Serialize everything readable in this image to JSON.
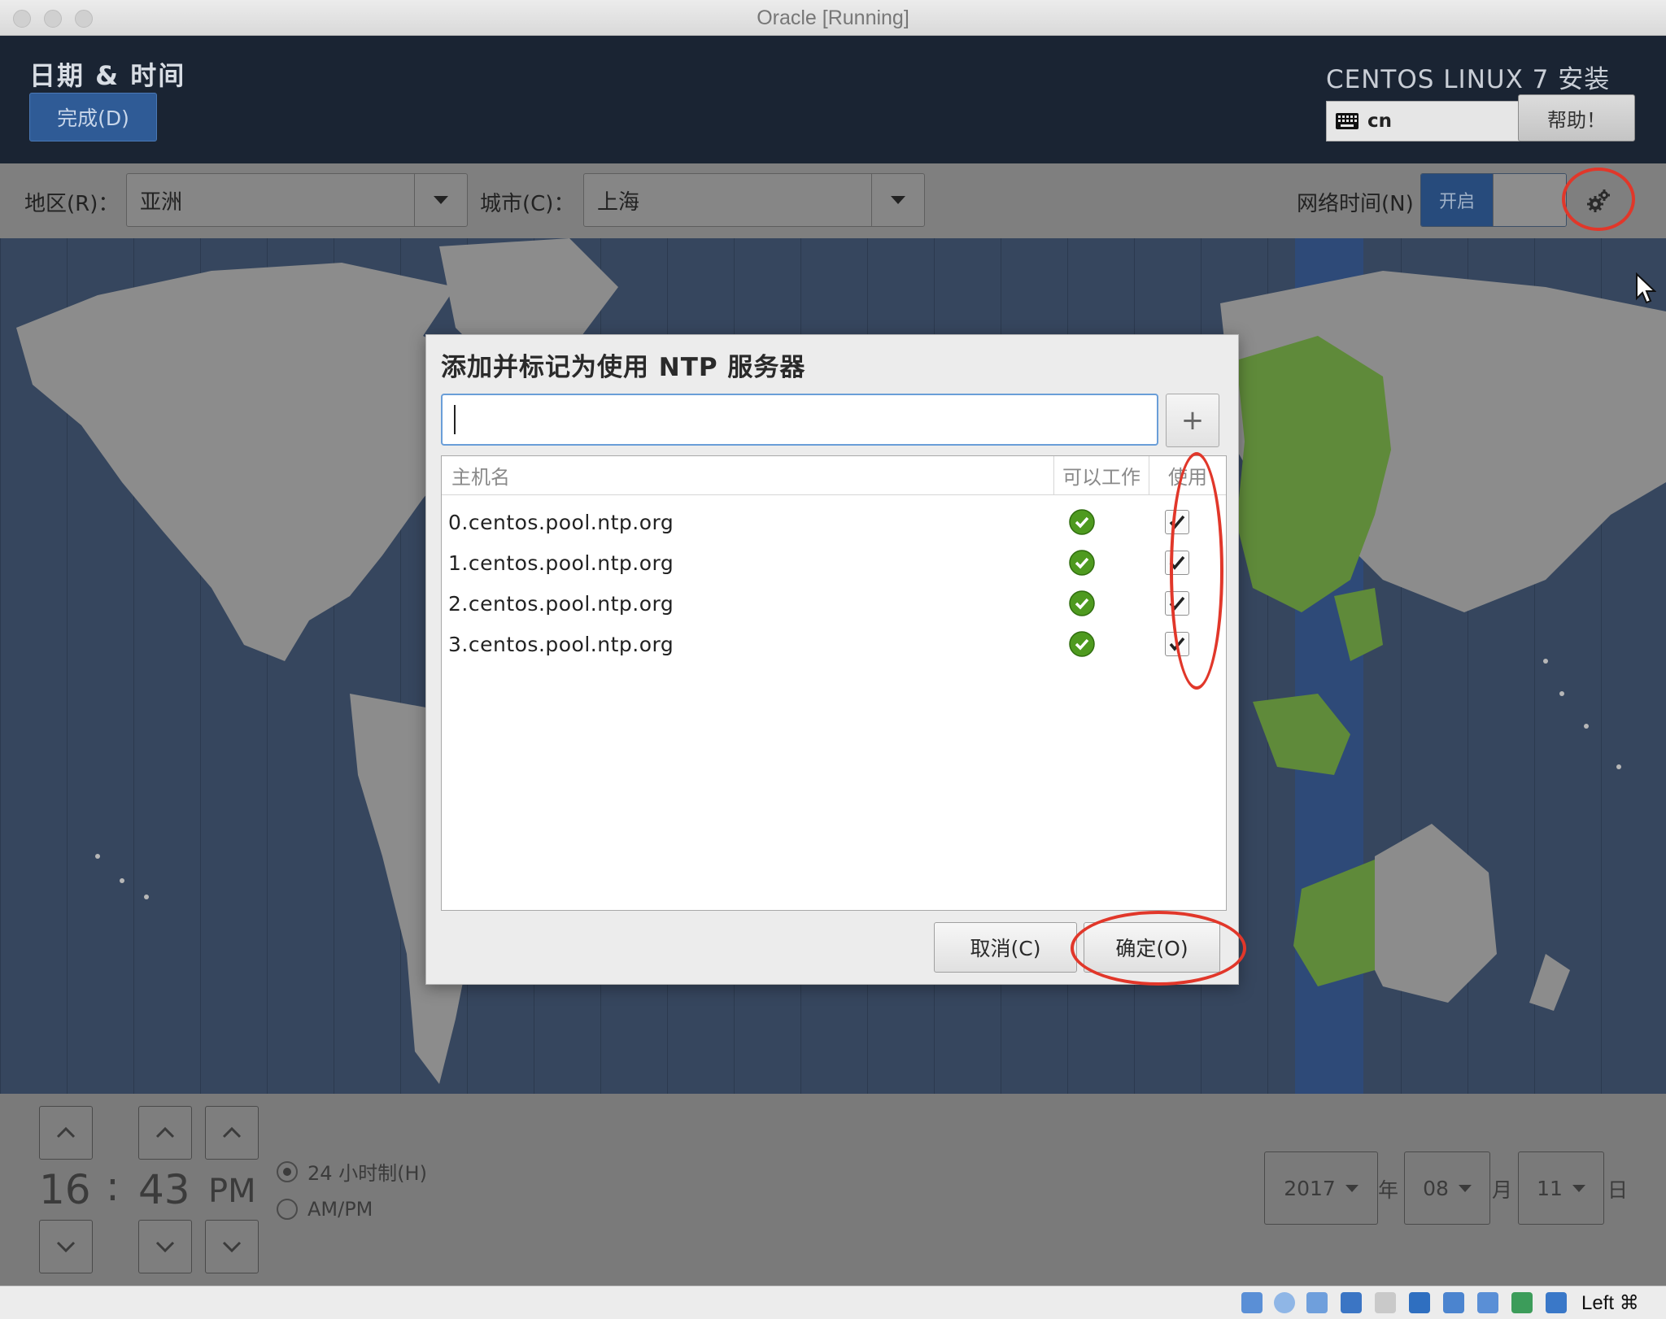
{
  "window": {
    "title": "Oracle [Running]"
  },
  "header": {
    "spoke_title": "日期 & 时间",
    "done_button": "完成(D)",
    "product_title": "CENTOS LINUX 7 安装",
    "keyboard_layout": "cn",
    "help_button": "帮助！"
  },
  "toolbar": {
    "region_label": "地区(R)：",
    "region_value": "亚洲",
    "city_label": "城市(C)：",
    "city_value": "上海",
    "network_time_label": "网络时间(N)",
    "network_time_state": "开启"
  },
  "dialog": {
    "title": "添加并标记为使用 NTP 服务器",
    "input_value": "",
    "add_button": "+",
    "columns": {
      "hostname": "主机名",
      "working": "可以工作",
      "use": "使用"
    },
    "servers": [
      {
        "host": "0.centos.pool.ntp.org",
        "working": true,
        "use": true
      },
      {
        "host": "1.centos.pool.ntp.org",
        "working": true,
        "use": true
      },
      {
        "host": "2.centos.pool.ntp.org",
        "working": true,
        "use": true
      },
      {
        "host": "3.centos.pool.ntp.org",
        "working": true,
        "use": true
      }
    ],
    "cancel_button": "取消(C)",
    "ok_button": "确定(O)"
  },
  "time": {
    "hours": "16",
    "separator": ":",
    "minutes": "43",
    "ampm": "PM",
    "format_24h_label": "24 小时制(H)",
    "format_ampm_label": "AM/PM",
    "selected_format": "24h"
  },
  "date": {
    "year": "2017",
    "year_unit": "年",
    "month": "08",
    "month_unit": "月",
    "day": "11",
    "day_unit": "日"
  },
  "statusbar": {
    "host_key": "Left ⌘"
  },
  "colors": {
    "header_bg": "#1a2433",
    "done_button_bg": "#2f5b96",
    "map_bg": "#36465e",
    "selected_zone": "#5f8a3a",
    "annotation_red": "#e1372a",
    "ok_green": "#4e9a1f"
  },
  "icons": [
    "keyboard-icon",
    "gear-icon",
    "plus-icon",
    "check-circle-icon",
    "checkbox-checked-icon",
    "chevron-up-icon",
    "chevron-down-icon",
    "mouse-pointer-icon"
  ]
}
